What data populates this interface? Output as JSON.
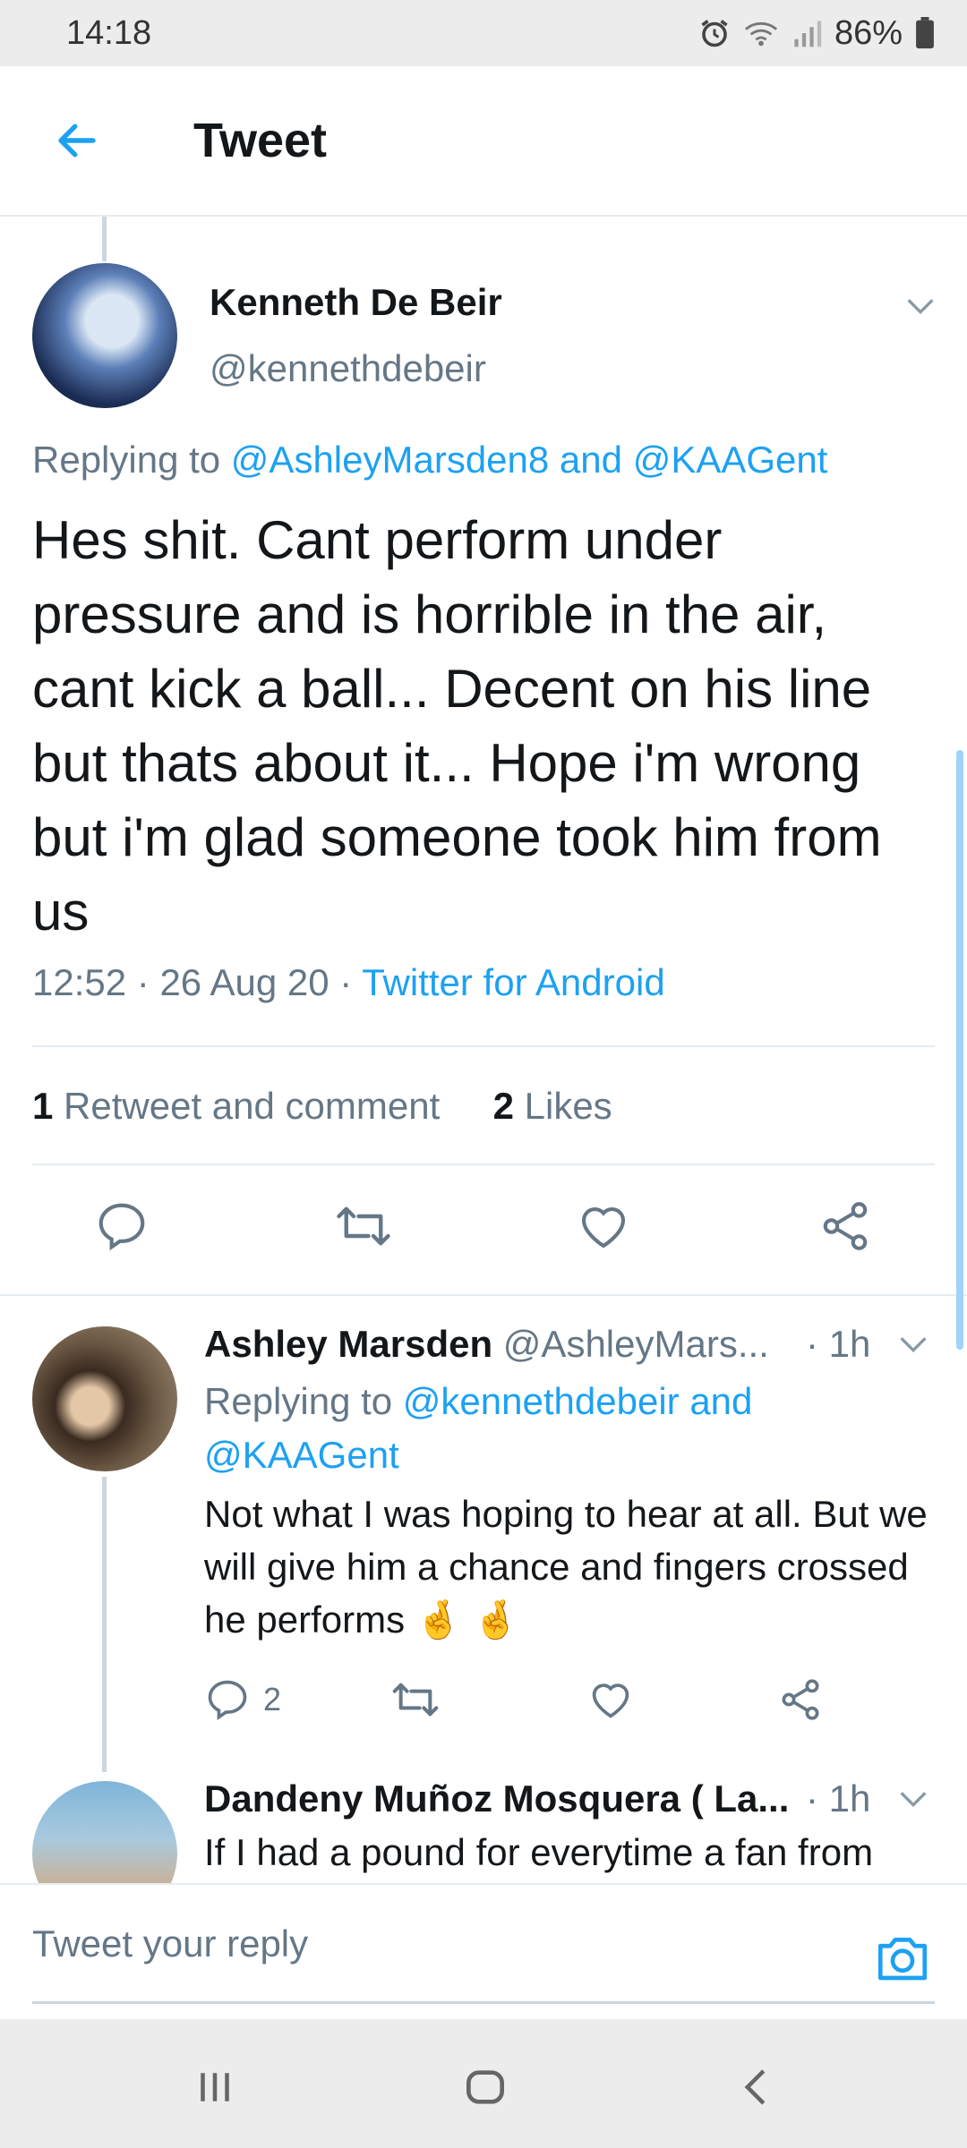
{
  "status_bar": {
    "time": "14:18",
    "battery": "86%",
    "icons": [
      "alarm-icon",
      "wifi-icon",
      "signal-icon",
      "battery-icon"
    ]
  },
  "app_bar": {
    "title": "Tweet",
    "back_icon": "arrow-left-icon"
  },
  "main_tweet": {
    "name": "Kenneth De Beir",
    "handle": "@kennethdebeir",
    "replying_prefix": "Replying to ",
    "replying_to_1": "@AshleyMarsden8",
    "replying_and": " and ",
    "replying_to_2": "@KAAGent",
    "text": "Hes shit. Cant perform under pressure and is horrible in the air, cant kick a ball... Decent on his line but thats about it... Hope i'm wrong but i'm glad someone took him from us",
    "time": "12:52",
    "date": "26 Aug 20",
    "source": "Twitter for Android",
    "retweet_count": "1",
    "retweet_label": "Retweet and comment",
    "likes_count": "2",
    "likes_label": "Likes"
  },
  "replies": [
    {
      "name": "Ashley Marsden",
      "handle": "@AshleyMars...",
      "time": "· 1h",
      "replying_prefix": "Replying to ",
      "replying_text": "@kennethdebeir and @KAAGent",
      "text": "Not what I was hoping to hear at all. But we will give him a chance and fingers crossed he performs 🤞 🤞",
      "reply_count": "2"
    },
    {
      "name": "Dandeny Muñoz Mosquera ( La...",
      "time": "· 1h",
      "text": "If I had a pound for everytime a fan from"
    }
  ],
  "compose": {
    "placeholder": "Tweet your reply"
  },
  "colors": {
    "accent": "#1da1f2",
    "secondary_text": "#657786",
    "primary_text": "#14171a"
  }
}
